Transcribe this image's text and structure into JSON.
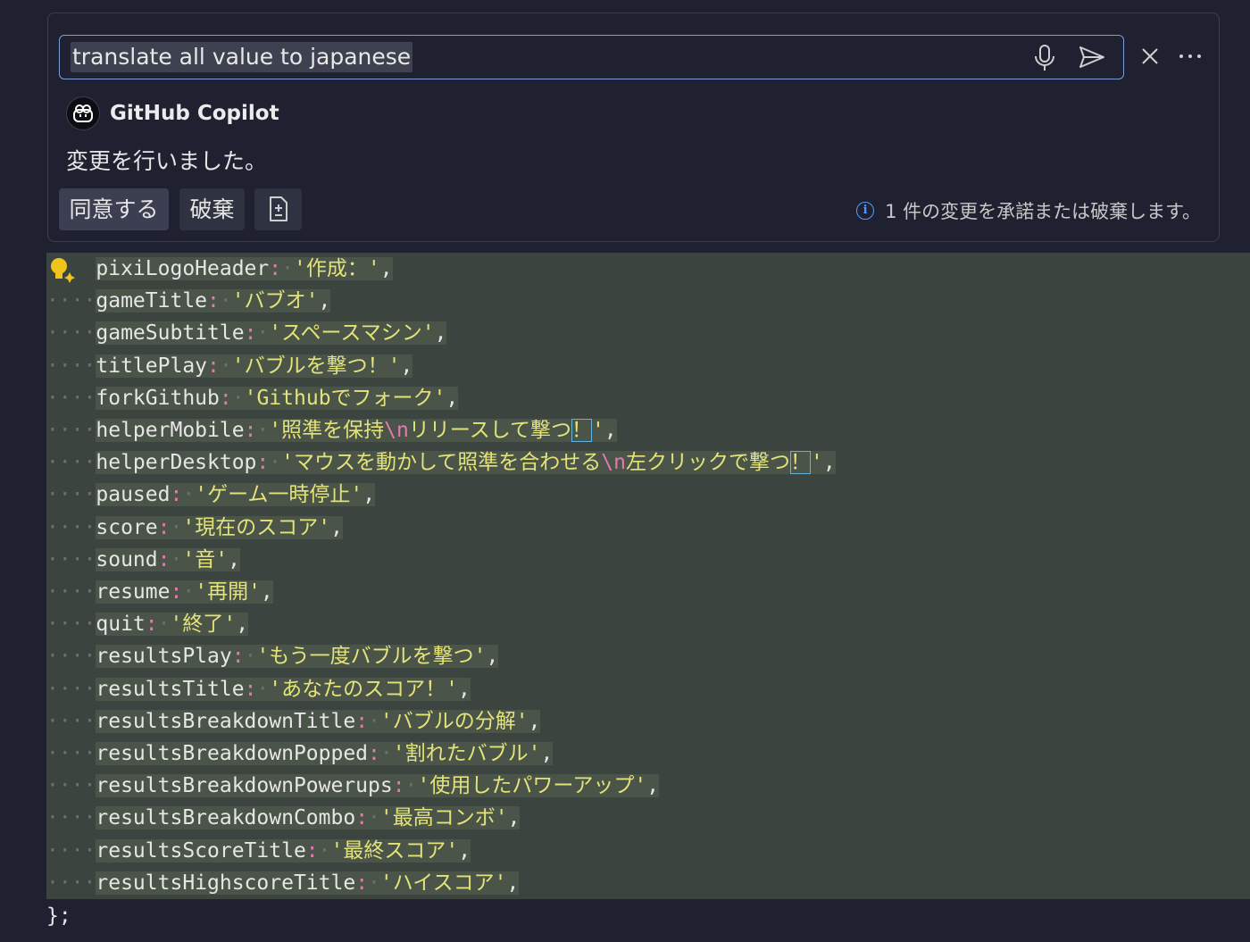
{
  "chat": {
    "prompt_value": "translate all value to japanese",
    "author_name": "GitHub Copilot",
    "reply": "変更を行いました。",
    "accept_label": "同意する",
    "discard_label": "破棄",
    "info_text": "1 件の変更を承諾または破棄します。",
    "info_icon_glyph": "i"
  },
  "colors": {
    "panel_bg": "#1f2130",
    "input_border": "#7f9cd6",
    "diff_bg": "#3c4440",
    "string": "#e3e37a",
    "escape": "#e07ab0",
    "info_blue": "#4f9cff"
  },
  "icons": [
    "microphone-icon",
    "send-icon",
    "close-icon",
    "more-icon",
    "copilot-icon",
    "diff-file-icon",
    "info-icon",
    "lightbulb-sparkle-icon"
  ],
  "code": {
    "lines": [
      {
        "key": "pixiLogoHeader",
        "parts": [
          "作成："
        ]
      },
      {
        "key": "gameTitle",
        "parts": [
          "バブオ"
        ]
      },
      {
        "key": "gameSubtitle",
        "parts": [
          "スペースマシン"
        ]
      },
      {
        "key": "titlePlay",
        "parts": [
          "バブルを撃つ！"
        ]
      },
      {
        "key": "forkGithub",
        "parts": [
          "Githubでフォーク"
        ]
      },
      {
        "key": "helperMobile",
        "parts": [
          "照準を保持",
          "\\n",
          "リリースして撃つ",
          "！"
        ]
      },
      {
        "key": "helperDesktop",
        "parts": [
          "マウスを動かして照準を合わせる",
          "\\n",
          "左クリックで撃つ",
          "！"
        ]
      },
      {
        "key": "paused",
        "parts": [
          "ゲーム一時停止"
        ]
      },
      {
        "key": "score",
        "parts": [
          "現在のスコア"
        ]
      },
      {
        "key": "sound",
        "parts": [
          "音"
        ]
      },
      {
        "key": "resume",
        "parts": [
          "再開"
        ]
      },
      {
        "key": "quit",
        "parts": [
          "終了"
        ]
      },
      {
        "key": "resultsPlay",
        "parts": [
          "もう一度バブルを撃つ"
        ]
      },
      {
        "key": "resultsTitle",
        "parts": [
          "あなたのスコア！"
        ]
      },
      {
        "key": "resultsBreakdownTitle",
        "parts": [
          "バブルの分解"
        ]
      },
      {
        "key": "resultsBreakdownPopped",
        "parts": [
          "割れたバブル"
        ]
      },
      {
        "key": "resultsBreakdownPowerups",
        "parts": [
          "使用したパワーアップ"
        ]
      },
      {
        "key": "resultsBreakdownCombo",
        "parts": [
          "最高コンボ"
        ]
      },
      {
        "key": "resultsScoreTitle",
        "parts": [
          "最終スコア"
        ]
      },
      {
        "key": "resultsHighscoreTitle",
        "parts": [
          "ハイスコア"
        ]
      }
    ],
    "closing": "};"
  }
}
